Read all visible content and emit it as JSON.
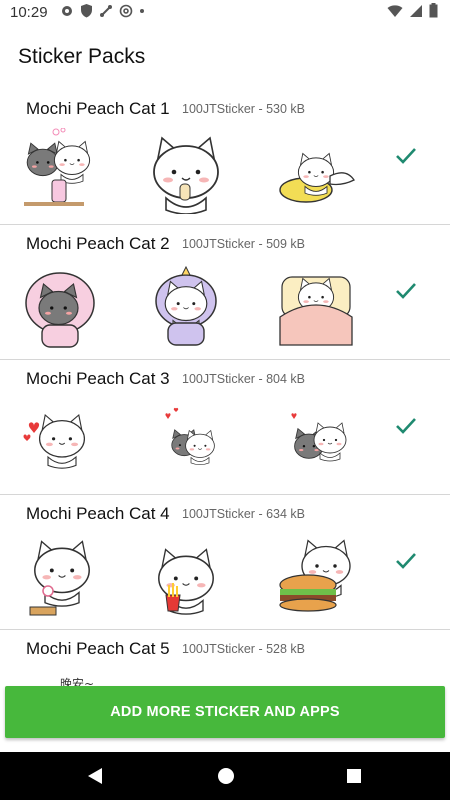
{
  "status": {
    "time": "10:29",
    "icons": [
      "gear-icon",
      "shield-icon",
      "network-icon",
      "at-icon",
      "dot-icon"
    ],
    "right_icons": [
      "wifi-icon",
      "signal-icon",
      "battery-icon"
    ]
  },
  "header": {
    "title": "Sticker Packs"
  },
  "packs": [
    {
      "name": "Mochi Peach Cat 1",
      "publisher": "100JTSticker",
      "separator": "-",
      "size": "530 kB",
      "added": true
    },
    {
      "name": "Mochi Peach Cat 2",
      "publisher": "100JTSticker",
      "separator": "-",
      "size": "509 kB",
      "added": true
    },
    {
      "name": "Mochi Peach Cat 3",
      "publisher": "100JTSticker",
      "separator": "-",
      "size": "804 kB",
      "added": true
    },
    {
      "name": "Mochi Peach Cat 4",
      "publisher": "100JTSticker",
      "separator": "-",
      "size": "634 kB",
      "added": true
    },
    {
      "name": "Mochi Peach Cat 5",
      "publisher": "100JTSticker",
      "separator": "-",
      "size": "528 kB",
      "added": false
    }
  ],
  "sticker_5_text": "晚安~",
  "bottom": {
    "button_label": "ADD MORE STICKER AND APPS"
  },
  "colors": {
    "accent_green": "#47b83c",
    "check_teal": "#1f8a70",
    "nav_bg": "#000000"
  }
}
